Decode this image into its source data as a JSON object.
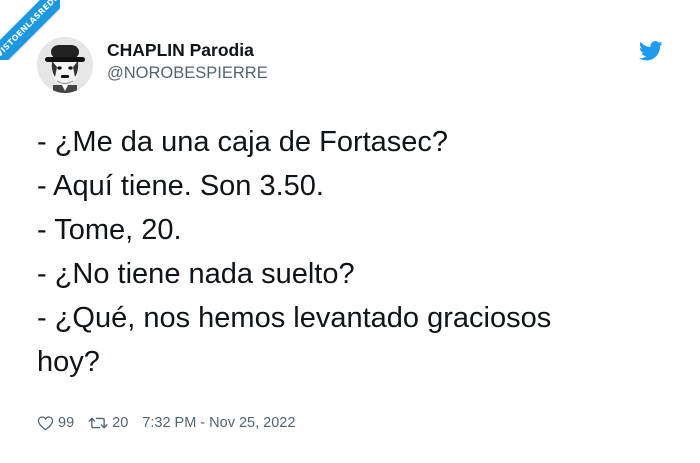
{
  "watermark": "VISTOENLASREDES",
  "author": {
    "display_name": "CHAPLIN Parodia",
    "handle": "@NOROBESPIERRE"
  },
  "tweet": {
    "lines": [
      "- ¿Me da una caja de Fortasec?",
      "- Aquí tiene. Son 3.50.",
      "- Tome, 20.",
      "- ¿No tiene nada suelto?",
      "- ¿Qué, nos hemos levantado graciosos",
      "hoy?"
    ]
  },
  "footer": {
    "likes": "99",
    "retweets": "20",
    "timestamp": "7:32 PM - Nov 25, 2022"
  },
  "icons": {
    "brand": "twitter-bird-icon",
    "like": "heart-icon",
    "retweet": "retweet-icon"
  },
  "colors": {
    "brand_blue": "#1d9bf0",
    "text_primary": "#0f1419",
    "text_secondary": "#536471",
    "watermark_blue": "#1b98e0"
  }
}
